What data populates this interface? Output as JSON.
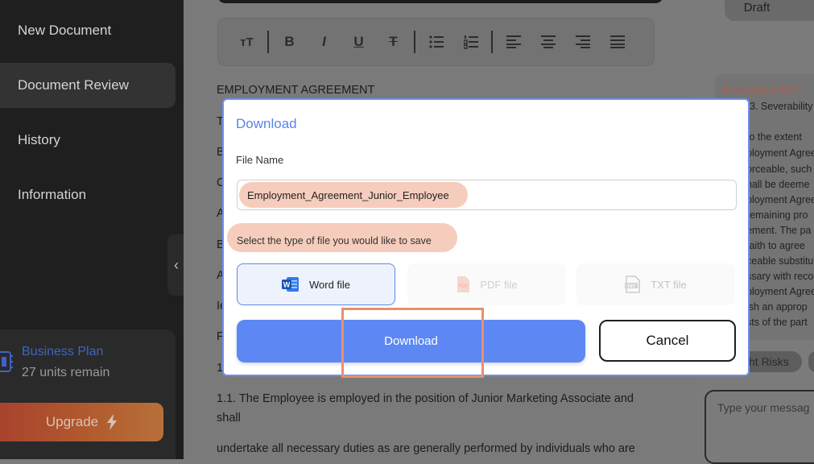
{
  "sidebar": {
    "items": [
      {
        "label": "New Document"
      },
      {
        "label": "Document Review"
      },
      {
        "label": "History"
      },
      {
        "label": "Information"
      }
    ],
    "active_index": 1,
    "plan": {
      "name": "Business Plan",
      "units": "27 units remain"
    },
    "upgrade_label": "Upgrade"
  },
  "editor": {
    "toolbar": {
      "font_size": "тT",
      "bold": "B",
      "italic": "I",
      "underline": "U",
      "strike": "T"
    },
    "document_lines": [
      {
        "text": "EMPLOYMENT AGREEMENT"
      },
      {
        "text": "T"
      },
      {
        "text": "B"
      },
      {
        "text": "C"
      },
      {
        "text": "A"
      },
      {
        "text": "B"
      },
      {
        "text": "A"
      },
      {
        "text": "Ie"
      },
      {
        "text": "F"
      },
      {
        "text": "1"
      },
      {
        "text": "1.1. The Employee is employed in the position of Junior Marketing Associate and"
      },
      {
        "text": "shall"
      },
      {
        "text": "undertake all necessary duties as are generally performed by individuals who are"
      }
    ]
  },
  "chat": {
    "draft_label": "Draft",
    "bot_name": "DocLegal.ai BOT",
    "bot_lines": [
      "3. Severability",
      "to the extent",
      "ployment Agree",
      "orceable, such",
      "hall be deeme",
      "ployment Agree",
      "remaining pro",
      "ement. The pa",
      "faith to agree",
      "ceable substitu",
      "ssary with reco",
      "ployment Agree",
      "ish an approp",
      "sts of the part"
    ],
    "risk_chip": "ht Risks",
    "input_placeholder": "Type your messag"
  },
  "modal": {
    "title": "Download",
    "file_name_label": "File Name",
    "file_name_value": "Employment_Agreement_Junior_Employee",
    "type_prompt": "Select the type of file you would like to save",
    "file_types": [
      {
        "label": "Word file",
        "icon": "word-icon",
        "selected": true
      },
      {
        "label": "PDF file",
        "icon": "pdf-icon",
        "selected": false
      },
      {
        "label": "TXT file",
        "icon": "txt-icon",
        "selected": false
      }
    ],
    "download_label": "Download",
    "cancel_label": "Cancel"
  },
  "colors": {
    "accent": "#5d87f3",
    "highlight": "#f6cdbd",
    "focus_box": "#e8906b",
    "sidebar_bg": "#1f1f1f"
  }
}
